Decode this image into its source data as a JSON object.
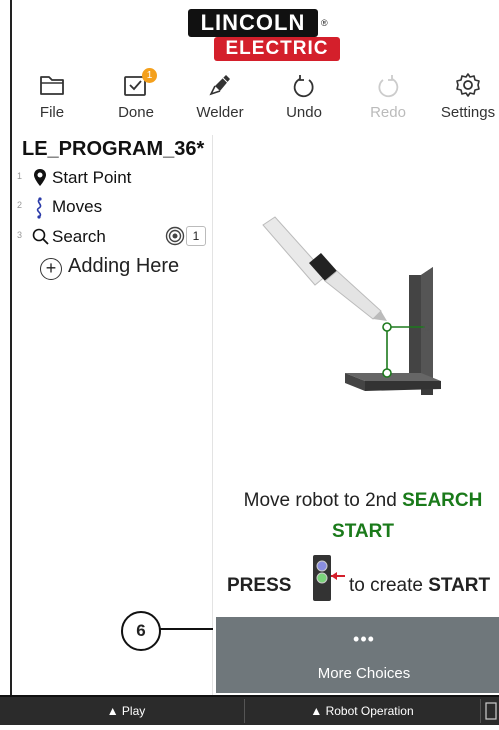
{
  "brand": {
    "line1": "LINCOLN",
    "line2": "ELECTRIC",
    "reg": "®",
    "colors": {
      "red": "#d41f2b",
      "black": "#111111"
    }
  },
  "toolbar": {
    "file": "File",
    "done": "Done",
    "done_badge": "1",
    "welder": "Welder",
    "undo": "Undo",
    "redo": "Redo",
    "settings": "Settings"
  },
  "program": {
    "title": "LE_PROGRAM_36*",
    "steps": [
      {
        "num": "1",
        "label": "Start Point",
        "icon": "location-pin-icon"
      },
      {
        "num": "2",
        "label": "Moves",
        "icon": "moves-icon"
      },
      {
        "num": "3",
        "label": "Search",
        "icon": "search-icon",
        "count": "1"
      }
    ],
    "adding": "Adding Here"
  },
  "main": {
    "instruction_pre": "Move robot to 2nd ",
    "instruction_highlight": "SEARCH START",
    "press": "PRESS",
    "create_pre": "to create ",
    "create_bold": "START",
    "more_dots": "•••",
    "more_label": "More Choices"
  },
  "callout": {
    "number": "6"
  },
  "bottom": {
    "play": "▲ Play",
    "robot_operation": "▲ Robot Operation"
  }
}
